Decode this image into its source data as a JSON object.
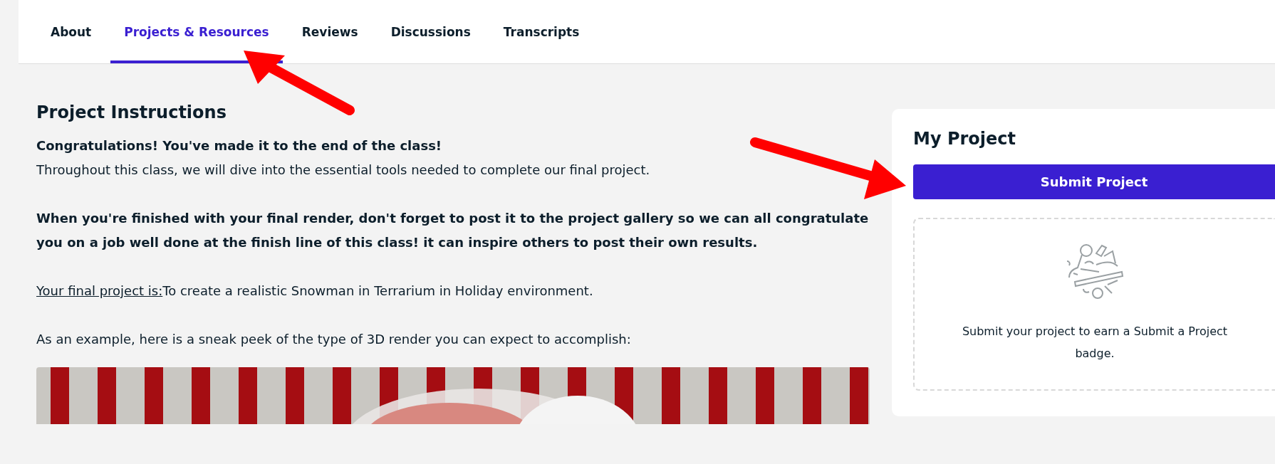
{
  "tabs": [
    {
      "label": "About",
      "selected": false
    },
    {
      "label": "Projects & Resources",
      "selected": true
    },
    {
      "label": "Reviews",
      "selected": false
    },
    {
      "label": "Discussions",
      "selected": false
    },
    {
      "label": "Transcripts",
      "selected": false
    }
  ],
  "instructions": {
    "title": "Project Instructions",
    "intro_heading": "Congratulations! You've made it to the end of the class!",
    "intro_text": "Throughout this class, we will dive into the essential tools needed to complete our final project.",
    "reminder": "When you're finished with your final render, don't forget to post it to the project gallery so we can all congratulate you on a job well done at the finish line of this class! it can inspire others to post their own results.",
    "final_label": "Your final project is:",
    "final_text": "To create a realistic Snowman in Terrarium in Holiday environment.",
    "example_text": "As an example, here is a sneak peek of the type of 3D render you can expect to accomplish:"
  },
  "my_project": {
    "title": "My Project",
    "button": "Submit Project",
    "badge_text": "Submit your project to earn a Submit a Project badge."
  },
  "annotations": [
    {
      "kind": "arrow"
    },
    {
      "kind": "arrow"
    }
  ]
}
